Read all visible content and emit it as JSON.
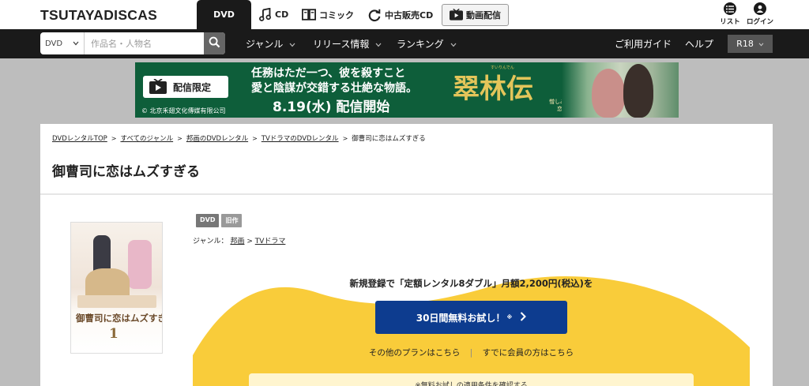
{
  "header": {
    "logo": "TSUTAYADISCAS",
    "tabs": [
      {
        "label": "DVD",
        "icon": "none"
      },
      {
        "label": "CD",
        "icon": "music-note-icon"
      },
      {
        "label": "コミック",
        "icon": "book-icon"
      },
      {
        "label": "中古販売CD",
        "icon": "refresh-icon"
      },
      {
        "label": "動画配信",
        "icon": "play-icon"
      }
    ],
    "utility": [
      {
        "label": "リスト",
        "icon": "list-icon"
      },
      {
        "label": "ログイン",
        "icon": "user-icon"
      }
    ]
  },
  "navbar": {
    "search": {
      "category": "DVD",
      "placeholder": "作品名・人物名"
    },
    "menus": [
      "ジャンル",
      "リリース情報",
      "ランキング"
    ],
    "guide": "ご利用ガイド",
    "help": "ヘルプ",
    "r18": "R18"
  },
  "banner": {
    "badge": "配信限定",
    "line1": "任務はただ一つ、彼を殺すこと",
    "line2": "愛と陰謀が交錯する壮絶な物語。",
    "line3": "8.19(水) 配信開始",
    "copyright": "© 北京禾翅文化傳媒有限公司",
    "title": "翠林伝",
    "ruby": "すいりんでん",
    "subtitle_1": "憎しみから始まった",
    "subtitle_2": "恋の行方"
  },
  "breadcrumb": [
    "DVDレンタルTOP",
    "すべてのジャンル",
    "邦画のDVDレンタル",
    "TVドラマのDVDレンタル",
    "御曹司に恋はムズすぎる"
  ],
  "product": {
    "title": "御曹司に恋はムズすぎる",
    "cover_title": "御曹司に恋はムズすぎる",
    "cover_vol": "1",
    "badges": [
      "DVD",
      "旧作"
    ],
    "genre_label": "ジャンル：",
    "genres": [
      "邦画",
      "TVドラマ"
    ]
  },
  "promo": {
    "headline": "新規登録で「定額レンタル8ダブル」月額2,200円(税込)を",
    "cta_label": "30日間無料お試し！",
    "cta_note": "※",
    "link_plans": "その他のプランはこちら",
    "link_members": "すでに会員の方はこちら",
    "conditions": "※無料お試しの適用条件を確認する"
  },
  "colors": {
    "navy_cta": "#0d3c8f",
    "promo_yellow": "#f9cc3a",
    "banner_green": "#0e5e3a",
    "header_dark": "#1a1a1a"
  }
}
